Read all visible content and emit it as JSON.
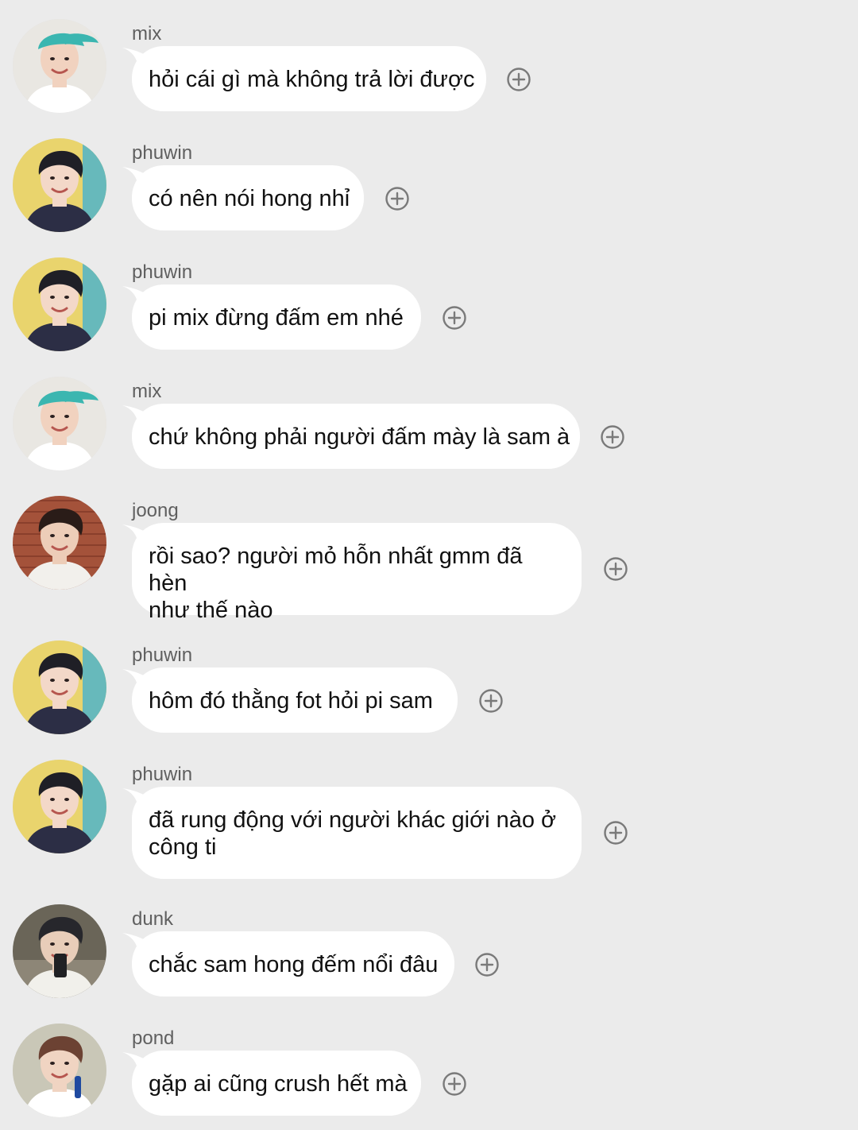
{
  "colors": {
    "background": "#ebebeb",
    "bubble": "#ffffff",
    "sender_text": "#5f5f5f",
    "message_text": "#111111",
    "plus_icon": "#7a7a7a"
  },
  "avatars": {
    "mix": {
      "icon": "avatar-mix-photo",
      "bg": "#e9e7e2",
      "cap": "#3bb6b0",
      "skin": "#f1d2bf",
      "hair": "#2a2020"
    },
    "phuwin": {
      "icon": "avatar-phuwin-photo",
      "bg": "#e9d46d",
      "bg2": "#67b9bb",
      "skin": "#f3d8c8",
      "hair": "#1f1f26",
      "shirt": "#2c2e45"
    },
    "joong": {
      "icon": "avatar-joong-photo",
      "bg": "#a4523a",
      "skin": "#edcdb8",
      "hair": "#2a1c18",
      "shirt": "#f2f0ec"
    },
    "dunk": {
      "icon": "avatar-dunk-photo",
      "bg": "#6a6558",
      "skin": "#e8cdb9",
      "hair": "#27272c",
      "shirt": "#f1f0eb"
    },
    "pond": {
      "icon": "avatar-pond-photo",
      "bg": "#c9c7b7",
      "skin": "#f0d4c2",
      "hair": "#6c4233",
      "shirt": "#ffffff"
    }
  },
  "messages": [
    {
      "sender": "mix",
      "avatar": "mix",
      "text": "hỏi cái gì mà không trả lời được"
    },
    {
      "sender": "phuwin",
      "avatar": "phuwin",
      "text": "có nên nói hong nhỉ"
    },
    {
      "sender": "phuwin",
      "avatar": "phuwin",
      "text": "pi mix đừng đấm em nhé"
    },
    {
      "sender": "mix",
      "avatar": "mix",
      "text": "chứ không phải người đấm mày là sam à"
    },
    {
      "sender": "joong",
      "avatar": "joong",
      "text": "rồi sao? người mỏ hỗn nhất gmm đã hèn\nnhư thế nào"
    },
    {
      "sender": "phuwin",
      "avatar": "phuwin",
      "text": "hôm đó thằng fot hỏi pi sam"
    },
    {
      "sender": "phuwin",
      "avatar": "phuwin",
      "text": "đã rung động với người khác giới nào ở\ncông ti"
    },
    {
      "sender": "dunk",
      "avatar": "dunk",
      "text": "chắc sam hong đếm nổi đâu"
    },
    {
      "sender": "pond",
      "avatar": "pond",
      "text": "gặp ai cũng crush hết mà"
    }
  ],
  "add_reaction_icon": "plus-circle-icon"
}
